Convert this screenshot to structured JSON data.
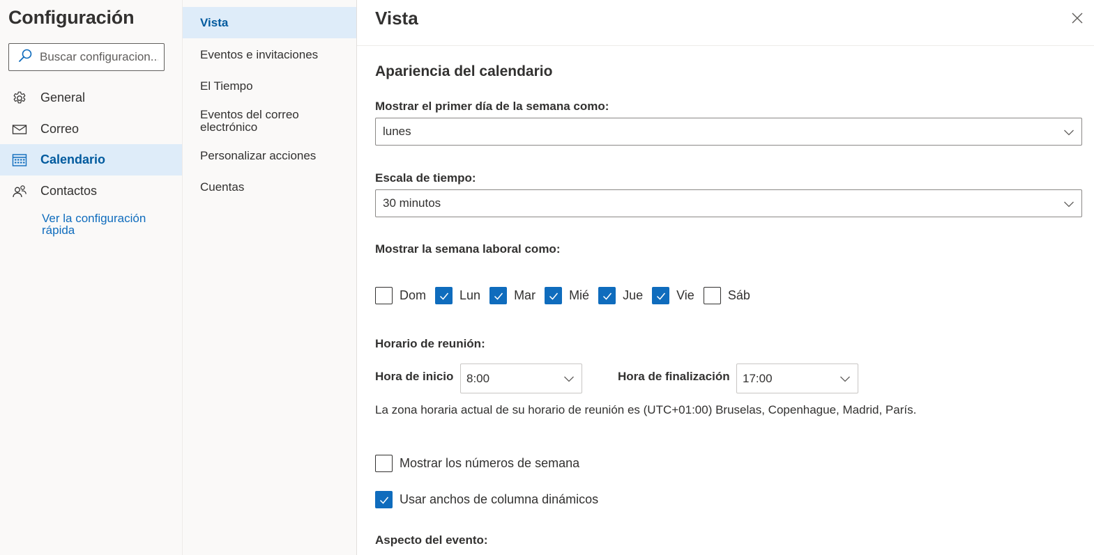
{
  "nav": {
    "title": "Configuración",
    "search": {
      "placeholder": "Buscar configuracion..."
    },
    "items": [
      {
        "label": "General",
        "icon": "gear-icon"
      },
      {
        "label": "Correo",
        "icon": "mail-icon"
      },
      {
        "label": "Calendario",
        "icon": "calendar-icon",
        "selected": true
      },
      {
        "label": "Contactos",
        "icon": "people-icon"
      }
    ],
    "quick_settings_link": "Ver la configuración rápida"
  },
  "subnav": {
    "items": [
      {
        "label": "Vista",
        "selected": true
      },
      {
        "label": "Eventos e invitaciones"
      },
      {
        "label": "El Tiempo"
      },
      {
        "label": "Eventos del correo electrónico"
      },
      {
        "label": "Personalizar acciones"
      },
      {
        "label": "Cuentas"
      }
    ]
  },
  "main": {
    "title": "Vista",
    "section_title": "Apariencia del calendario",
    "first_day": {
      "label": "Mostrar el primer día de la semana como:",
      "value": "lunes"
    },
    "time_scale": {
      "label": "Escala de tiempo:",
      "value": "30 minutos"
    },
    "work_week": {
      "label": "Mostrar la semana laboral como:",
      "days": [
        {
          "label": "Dom",
          "checked": false
        },
        {
          "label": "Lun",
          "checked": true
        },
        {
          "label": "Mar",
          "checked": true
        },
        {
          "label": "Mié",
          "checked": true
        },
        {
          "label": "Jue",
          "checked": true
        },
        {
          "label": "Vie",
          "checked": true
        },
        {
          "label": "Sáb",
          "checked": false
        }
      ]
    },
    "meeting_hours": {
      "label": "Horario de reunión:",
      "start_label": "Hora de inicio",
      "start_value": "8:00",
      "end_label": "Hora de finalización",
      "end_value": "17:00",
      "timezone_note": "La zona horaria actual de su horario de reunión es (UTC+01:00) Bruselas, Copenhague, Madrid, París."
    },
    "options": [
      {
        "label": "Mostrar los números de semana",
        "checked": false
      },
      {
        "label": "Usar anchos de columna dinámicos",
        "checked": true
      }
    ],
    "event_appearance_label": "Aspecto del evento:"
  },
  "colors": {
    "accent": "#0f6cbd",
    "selected_bg": "#deecf9",
    "selected_text": "#005a9e",
    "pane_bg": "#faf9f8"
  }
}
